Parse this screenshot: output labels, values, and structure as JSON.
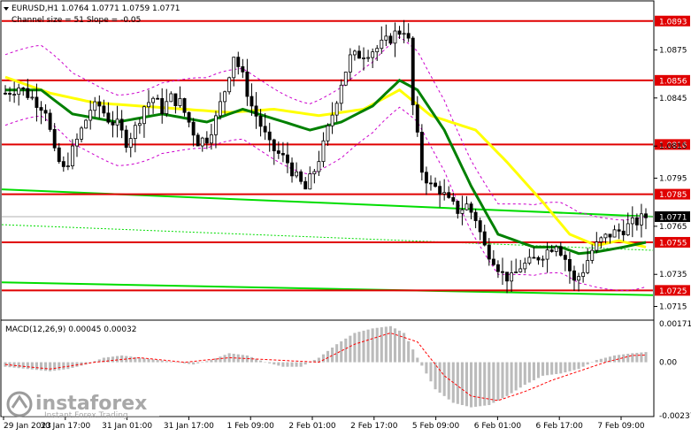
{
  "header": {
    "symbol_line": "EURUSD,H1  1.0764 1.0771 1.0759 1.0771",
    "channel_line": "Channel size = 51 Slope = -0.05"
  },
  "macd_header": "MACD(12,26,9) 0.00045 0.00032",
  "watermark": {
    "brand": "instaforex",
    "tagline": "Instant Forex Trading"
  },
  "colors": {
    "level_red": "#e00000",
    "level_green": "#00dd00",
    "ma_green": "#008000",
    "ma_yellow": "#ffff00",
    "envelope": "#cc00cc",
    "candles": "#000000",
    "macd_hist": "#bbbbbb",
    "macd_signal": "#ff0000"
  },
  "chart_data": {
    "type": "candlestick",
    "price_ylim": [
      1.0707,
      1.0905
    ],
    "price_ticks": [
      "1.0875",
      "1.0845",
      "1.0815",
      "1.0795",
      "1.0765",
      "1.0735",
      "1.0715"
    ],
    "levels": [
      {
        "label": "1.0893",
        "value": 1.0893
      },
      {
        "label": "1.0856",
        "value": 1.0856
      },
      {
        "label": "1.0816",
        "value": 1.0816
      },
      {
        "label": "1.0785",
        "value": 1.0785
      },
      {
        "label": "1.0755",
        "value": 1.0755
      },
      {
        "label": "1.0725",
        "value": 1.0725
      }
    ],
    "current_price": {
      "label": "1.0771",
      "value": 1.0771
    },
    "time_labels": [
      "29 Jan 2023",
      "30 Jan 17:00",
      "31 Jan 01:00",
      "31 Jan 17:00",
      "1 Feb 09:00",
      "2 Feb 01:00",
      "2 Feb 17:00",
      "5 Feb 09:00",
      "6 Feb 01:00",
      "6 Feb 17:00",
      "7 Feb 09:00"
    ],
    "close_path": [
      [
        0,
        1.0848
      ],
      [
        3,
        1.0852
      ],
      [
        6,
        1.0845
      ],
      [
        9,
        1.0838
      ],
      [
        11,
        1.081
      ],
      [
        13,
        1.08
      ],
      [
        15,
        1.0812
      ],
      [
        17,
        1.0825
      ],
      [
        19,
        1.0838
      ],
      [
        21,
        1.084
      ],
      [
        23,
        1.0832
      ],
      [
        25,
        1.0828
      ],
      [
        27,
        1.0818
      ],
      [
        29,
        1.0826
      ],
      [
        31,
        1.084
      ],
      [
        33,
        1.0845
      ],
      [
        35,
        1.0838
      ],
      [
        37,
        1.0845
      ],
      [
        39,
        1.0842
      ],
      [
        41,
        1.083
      ],
      [
        43,
        1.0818
      ],
      [
        45,
        1.082
      ],
      [
        47,
        1.0832
      ],
      [
        49,
        1.085
      ],
      [
        51,
        1.0872
      ],
      [
        53,
        1.0858
      ],
      [
        55,
        1.084
      ],
      [
        57,
        1.0828
      ],
      [
        59,
        1.0815
      ],
      [
        61,
        1.081
      ],
      [
        63,
        1.0805
      ],
      [
        65,
        1.0795
      ],
      [
        67,
        1.0788
      ],
      [
        69,
        1.08
      ],
      [
        71,
        1.0815
      ],
      [
        73,
        1.0835
      ],
      [
        75,
        1.0855
      ],
      [
        77,
        1.087
      ],
      [
        79,
        1.0872
      ],
      [
        81,
        1.0874
      ],
      [
        83,
        1.0876
      ],
      [
        85,
        1.088
      ],
      [
        87,
        1.0885
      ],
      [
        89,
        1.0888
      ],
      [
        90,
        1.088
      ],
      [
        91,
        1.084
      ],
      [
        93,
        1.08
      ],
      [
        95,
        1.079
      ],
      [
        97,
        1.0788
      ],
      [
        99,
        1.078
      ],
      [
        101,
        1.0775
      ],
      [
        103,
        1.0778
      ],
      [
        105,
        1.077
      ],
      [
        107,
        1.0752
      ],
      [
        109,
        1.0745
      ],
      [
        111,
        1.0735
      ],
      [
        113,
        1.0732
      ],
      [
        115,
        1.074
      ],
      [
        117,
        1.0742
      ],
      [
        119,
        1.0746
      ],
      [
        121,
        1.075
      ],
      [
        123,
        1.0755
      ],
      [
        125,
        1.0745
      ],
      [
        127,
        1.073
      ],
      [
        129,
        1.0738
      ],
      [
        131,
        1.075
      ],
      [
        133,
        1.0756
      ],
      [
        135,
        1.076
      ],
      [
        137,
        1.0762
      ],
      [
        139,
        1.0765
      ],
      [
        141,
        1.0768
      ],
      [
        143,
        1.0771
      ]
    ],
    "ma_green": [
      [
        0,
        1.085
      ],
      [
        8,
        1.085
      ],
      [
        15,
        1.0835
      ],
      [
        25,
        1.083
      ],
      [
        35,
        1.0835
      ],
      [
        45,
        1.083
      ],
      [
        53,
        1.0838
      ],
      [
        60,
        1.0832
      ],
      [
        68,
        1.0825
      ],
      [
        75,
        1.083
      ],
      [
        82,
        1.084
      ],
      [
        88,
        1.0856
      ],
      [
        92,
        1.085
      ],
      [
        98,
        1.0825
      ],
      [
        104,
        1.079
      ],
      [
        110,
        1.076
      ],
      [
        118,
        1.0752
      ],
      [
        124,
        1.0752
      ],
      [
        128,
        1.0748
      ],
      [
        132,
        1.0749
      ],
      [
        138,
        1.0752
      ],
      [
        143,
        1.0755
      ]
    ],
    "ma_yellow": [
      [
        0,
        1.0858
      ],
      [
        10,
        1.0848
      ],
      [
        20,
        1.0842
      ],
      [
        30,
        1.084
      ],
      [
        40,
        1.0838
      ],
      [
        50,
        1.0836
      ],
      [
        60,
        1.0838
      ],
      [
        70,
        1.0834
      ],
      [
        80,
        1.0838
      ],
      [
        88,
        1.085
      ],
      [
        95,
        1.0834
      ],
      [
        105,
        1.0825
      ],
      [
        112,
        1.0805
      ],
      [
        120,
        1.078
      ],
      [
        126,
        1.076
      ],
      [
        132,
        1.0753
      ],
      [
        137,
        1.0756
      ],
      [
        143,
        1.0752
      ]
    ],
    "macd": {
      "header": "MACD(12,26,9) 0.00045 0.00032",
      "ticks": [
        "0.00171",
        "0.00",
        "-0.00237"
      ],
      "range": [
        -0.00237,
        0.00171
      ],
      "histogram": [
        [
          0,
          -0.0002
        ],
        [
          5,
          -0.0003
        ],
        [
          10,
          -0.0004
        ],
        [
          14,
          -0.0003
        ],
        [
          18,
          -0.0001
        ],
        [
          22,
          0.0002
        ],
        [
          26,
          0.0003
        ],
        [
          30,
          0.0002
        ],
        [
          34,
          0.0001
        ],
        [
          38,
          0.0
        ],
        [
          42,
          -0.0001
        ],
        [
          46,
          0.0001
        ],
        [
          50,
          0.0004
        ],
        [
          54,
          0.0003
        ],
        [
          58,
          0.0
        ],
        [
          62,
          -0.0002
        ],
        [
          66,
          -0.0002
        ],
        [
          70,
          0.0002
        ],
        [
          74,
          0.0008
        ],
        [
          78,
          0.0013
        ],
        [
          82,
          0.0015
        ],
        [
          86,
          0.0016
        ],
        [
          89,
          0.0013
        ],
        [
          92,
          0.0002
        ],
        [
          96,
          -0.0012
        ],
        [
          100,
          -0.0018
        ],
        [
          104,
          -0.002
        ],
        [
          108,
          -0.0019
        ],
        [
          112,
          -0.0015
        ],
        [
          116,
          -0.001
        ],
        [
          120,
          -0.0006
        ],
        [
          124,
          -0.0005
        ],
        [
          128,
          -0.0003
        ],
        [
          132,
          0.0001
        ],
        [
          136,
          0.0003
        ],
        [
          140,
          0.0004
        ],
        [
          143,
          0.00045
        ]
      ],
      "signal": [
        [
          0,
          -0.0001
        ],
        [
          10,
          -0.0003
        ],
        [
          20,
          0.0
        ],
        [
          30,
          0.0002
        ],
        [
          40,
          0.0
        ],
        [
          50,
          0.0002
        ],
        [
          60,
          0.0001
        ],
        [
          70,
          0.0
        ],
        [
          78,
          0.0008
        ],
        [
          86,
          0.0013
        ],
        [
          92,
          0.0009
        ],
        [
          98,
          -0.0006
        ],
        [
          104,
          -0.0015
        ],
        [
          110,
          -0.0017
        ],
        [
          116,
          -0.0013
        ],
        [
          122,
          -0.0008
        ],
        [
          128,
          -0.0004
        ],
        [
          134,
          0.0
        ],
        [
          140,
          0.0003
        ],
        [
          143,
          0.00032
        ]
      ]
    }
  }
}
